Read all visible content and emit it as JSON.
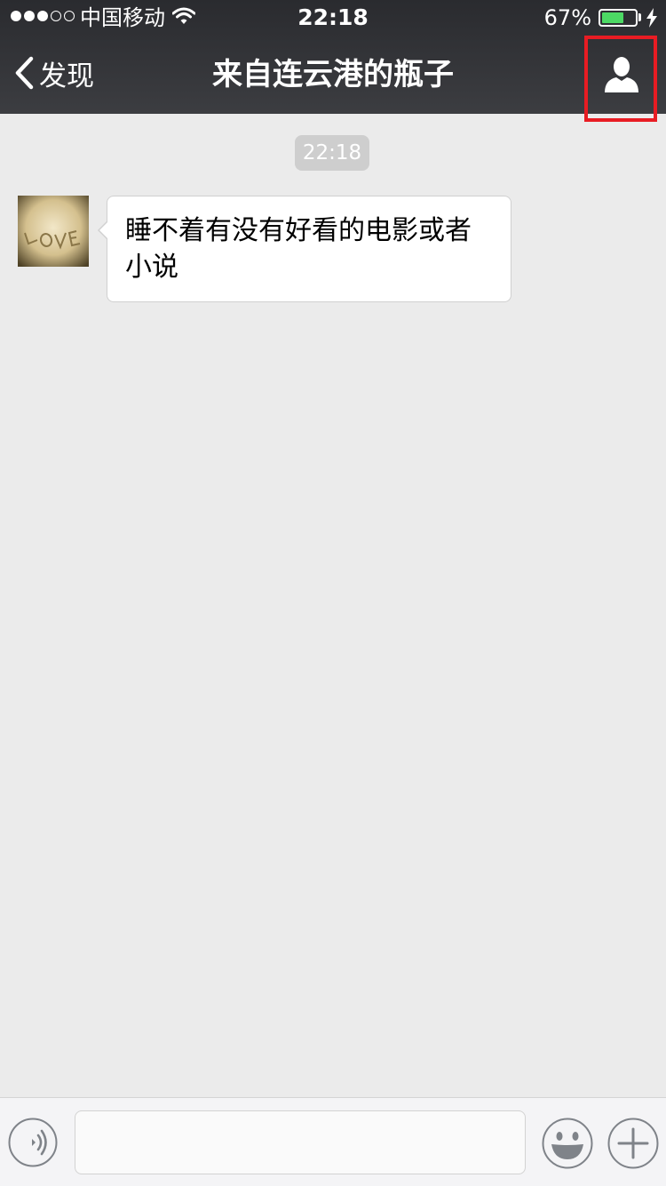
{
  "status_bar": {
    "carrier": "中国移动",
    "time": "22:18",
    "battery_percent_label": "67%",
    "battery_level": 0.67,
    "signal_bars_filled": 3,
    "signal_bars_total": 5
  },
  "nav": {
    "back_label": "发现",
    "title": "来自连云港的瓶子"
  },
  "chat": {
    "timestamp": "22:18",
    "messages": [
      {
        "sender": "other",
        "text": "睡不着有没有好看的电影或者小说"
      }
    ]
  },
  "input_bar": {
    "text_value": "",
    "placeholder": ""
  },
  "colors": {
    "nav_background": "#3c3d41",
    "chat_background": "#ebebeb",
    "battery_fill": "#4cd964",
    "highlight_border": "#e81c23",
    "timestamp_chip": "#cecece"
  },
  "icons": {
    "back": "chevron-left-icon",
    "profile": "person-icon",
    "voice": "voice-icon",
    "emoji": "smiley-icon",
    "more": "plus-icon",
    "wifi": "wifi-icon",
    "battery": "battery-icon",
    "charging": "bolt-icon"
  }
}
